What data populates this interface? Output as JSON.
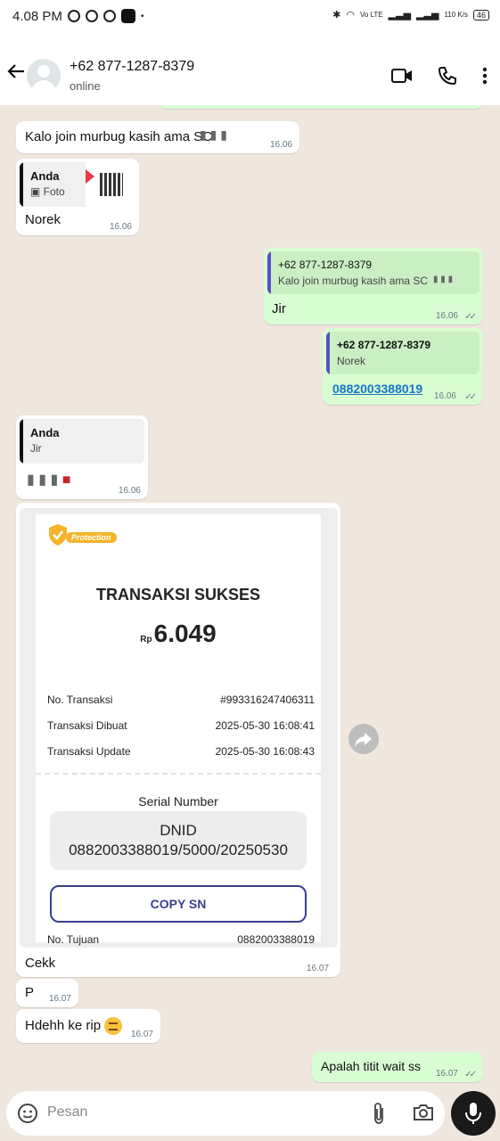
{
  "status_bar": {
    "time": "4.08 PM",
    "speed": "110 K/s",
    "battery": "46",
    "network": "Vo LTE"
  },
  "header": {
    "contact_name": "+62 877-1287-8379",
    "status": "online"
  },
  "messages": {
    "m1": {
      "text": "Kalo join murbug kasih ama SC",
      "time": "16.06"
    },
    "m2": {
      "quote_name": "Anda",
      "quote_text": "Foto",
      "text": "Norek",
      "time": "16.06"
    },
    "m3": {
      "quote_name": "+62 877-1287-8379",
      "quote_text": "Kalo join murbug kasih ama SC",
      "text": "Jir",
      "time": "16.06"
    },
    "m4": {
      "quote_name": "+62 877-1287-8379",
      "quote_text": "Norek",
      "text": "0882003388019",
      "time": "16.06"
    },
    "m5": {
      "quote_name": "Anda",
      "quote_text": "Jir",
      "time": "16.06"
    },
    "m6": {
      "caption": "Cekk",
      "time": "16.07"
    },
    "m7": {
      "text": "P",
      "time": "16.07"
    },
    "m8": {
      "text": "Hdehh ke rip",
      "time": "16.07"
    },
    "m9": {
      "text": "Apalah titit wait ss",
      "time": "16.07"
    }
  },
  "receipt": {
    "badge": "Protection",
    "title": "TRANSAKSI SUKSES",
    "currency": "Rp",
    "amount": "6.049",
    "rows": [
      {
        "label": "No. Transaksi",
        "value": "#993316247406311"
      },
      {
        "label": "Transaksi Dibuat",
        "value": "2025-05-30 16:08:41"
      },
      {
        "label": "Transaksi Update",
        "value": "2025-05-30 16:08:43"
      }
    ],
    "serial_title": "Serial Number",
    "serial_line1": "DNID",
    "serial_line2": "0882003388019/5000/20250530",
    "copy_label": "COPY SN",
    "last_label": "No. Tujuan",
    "last_value": "0882003388019"
  },
  "input": {
    "placeholder": "Pesan"
  },
  "colors": {
    "out_bubble": "#d9fdd3",
    "in_bubble": "#ffffff",
    "quote_bar": "#5b4fc4",
    "link": "#1a73c9"
  }
}
